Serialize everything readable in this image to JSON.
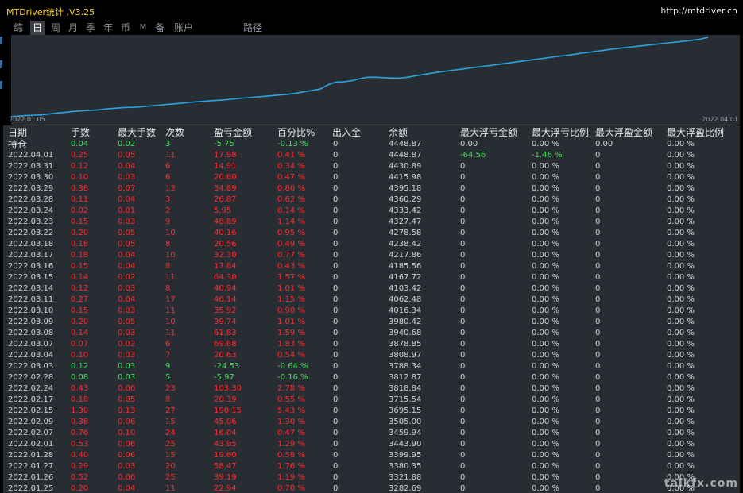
{
  "titlebar": {
    "app_title": "MTDriver统计 ,V3.25",
    "url": "http://mtdriver.cn"
  },
  "tabs": [
    {
      "label": "综",
      "active": false
    },
    {
      "label": "日",
      "active": true
    },
    {
      "label": "周",
      "active": false
    },
    {
      "label": "月",
      "active": false
    },
    {
      "label": "季",
      "active": false
    },
    {
      "label": "年",
      "active": false
    },
    {
      "label": "币",
      "active": false
    },
    {
      "label": "M",
      "active": false
    },
    {
      "label": "备",
      "active": false
    },
    {
      "label": "账户",
      "active": false
    },
    {
      "label": "路径",
      "active": false
    }
  ],
  "chart_data": {
    "type": "line",
    "x_start_label": "2022.01.05",
    "x_end_label": "2022.04.01",
    "line_color": "#29a3e0",
    "grid": false,
    "series": [
      {
        "values": [
          3300,
          3310,
          3318,
          3322,
          3330,
          3342,
          3355,
          3365,
          3378,
          3385,
          3392,
          3400,
          3412,
          3422,
          3430,
          3436,
          3440,
          3450,
          3460,
          3470,
          3480,
          3490,
          3500,
          3512,
          3520,
          3528,
          3536,
          3545,
          3556,
          3568,
          3575,
          3585,
          3595,
          3605,
          3615,
          3625,
          3640,
          3660,
          3680,
          3700,
          3760,
          3800,
          3805,
          3820,
          3850,
          3870,
          3872,
          3865,
          3860,
          3858,
          3870,
          3890,
          3910,
          3928,
          3945,
          3960,
          3975,
          3990,
          4005,
          4020,
          4035,
          4050,
          4065,
          4080,
          4095,
          4110,
          4125,
          4140,
          4158,
          4172,
          4185,
          4200,
          4218,
          4232,
          4248,
          4262,
          4278,
          4292,
          4305,
          4318,
          4330,
          4342,
          4355,
          4368,
          4380,
          4392,
          4405,
          4420,
          4448
        ]
      }
    ]
  },
  "table": {
    "headers": [
      "日期",
      "手数",
      "最大手数",
      "次数",
      "盈亏金额",
      "百分比%",
      "出入金",
      "余额",
      "最大浮亏金额",
      "最大浮亏比例",
      "最大浮盈金额",
      "最大浮盈比例"
    ],
    "holding": {
      "date": "持仓",
      "lots": "0.04",
      "max_lots": "0.02",
      "count": "3",
      "pl": "-5.75",
      "pct": "-0.13 %",
      "io": "0",
      "balance": "4448.87",
      "max_dd_amt": "0.00",
      "max_dd_pct": "0.00 %",
      "max_fp_amt": "0.00",
      "max_fp_pct": "0.00 %"
    },
    "rows": [
      {
        "date": "2022.04.01",
        "lots": "0.25",
        "max_lots": "0.05",
        "count": "11",
        "pl": "17.98",
        "pct": "0.41 %",
        "io": "0",
        "balance": "4448.87",
        "max_dd_amt": "-64.56",
        "max_dd_pct": "-1.46 %",
        "max_fp_amt": "0",
        "max_fp_pct": "0.00 %"
      },
      {
        "date": "2022.03.31",
        "lots": "0.12",
        "max_lots": "0.04",
        "count": "6",
        "pl": "14.91",
        "pct": "0.34 %",
        "io": "0",
        "balance": "4430.89",
        "max_dd_amt": "0",
        "max_dd_pct": "0.00 %",
        "max_fp_amt": "0",
        "max_fp_pct": "0.00 %"
      },
      {
        "date": "2022.03.30",
        "lots": "0.10",
        "max_lots": "0.03",
        "count": "6",
        "pl": "20.80",
        "pct": "0.47 %",
        "io": "0",
        "balance": "4415.98",
        "max_dd_amt": "0",
        "max_dd_pct": "0.00 %",
        "max_fp_amt": "0",
        "max_fp_pct": "0.00 %"
      },
      {
        "date": "2022.03.29",
        "lots": "0.38",
        "max_lots": "0.07",
        "count": "13",
        "pl": "34.89",
        "pct": "0.80 %",
        "io": "0",
        "balance": "4395.18",
        "max_dd_amt": "0",
        "max_dd_pct": "0.00 %",
        "max_fp_amt": "0",
        "max_fp_pct": "0.00 %"
      },
      {
        "date": "2022.03.28",
        "lots": "0.11",
        "max_lots": "0.04",
        "count": "3",
        "pl": "26.87",
        "pct": "0.62 %",
        "io": "0",
        "balance": "4360.29",
        "max_dd_amt": "0",
        "max_dd_pct": "0.00 %",
        "max_fp_amt": "0",
        "max_fp_pct": "0.00 %"
      },
      {
        "date": "2022.03.24",
        "lots": "0.02",
        "max_lots": "0.01",
        "count": "2",
        "pl": "5.95",
        "pct": "0.14 %",
        "io": "0",
        "balance": "4333.42",
        "max_dd_amt": "0",
        "max_dd_pct": "0.00 %",
        "max_fp_amt": "0",
        "max_fp_pct": "0.00 %"
      },
      {
        "date": "2022.03.23",
        "lots": "0.15",
        "max_lots": "0.03",
        "count": "9",
        "pl": "48.89",
        "pct": "1.14 %",
        "io": "0",
        "balance": "4327.47",
        "max_dd_amt": "0",
        "max_dd_pct": "0.00 %",
        "max_fp_amt": "0",
        "max_fp_pct": "0.00 %"
      },
      {
        "date": "2022.03.22",
        "lots": "0.20",
        "max_lots": "0.05",
        "count": "10",
        "pl": "40.16",
        "pct": "0.95 %",
        "io": "0",
        "balance": "4278.58",
        "max_dd_amt": "0",
        "max_dd_pct": "0.00 %",
        "max_fp_amt": "0",
        "max_fp_pct": "0.00 %"
      },
      {
        "date": "2022.03.18",
        "lots": "0.18",
        "max_lots": "0.05",
        "count": "8",
        "pl": "20.56",
        "pct": "0.49 %",
        "io": "0",
        "balance": "4238.42",
        "max_dd_amt": "0",
        "max_dd_pct": "0.00 %",
        "max_fp_amt": "0",
        "max_fp_pct": "0.00 %"
      },
      {
        "date": "2022.03.17",
        "lots": "0.18",
        "max_lots": "0.04",
        "count": "10",
        "pl": "32.30",
        "pct": "0.77 %",
        "io": "0",
        "balance": "4217.86",
        "max_dd_amt": "0",
        "max_dd_pct": "0.00 %",
        "max_fp_amt": "0",
        "max_fp_pct": "0.00 %"
      },
      {
        "date": "2022.03.16",
        "lots": "0.15",
        "max_lots": "0.04",
        "count": "8",
        "pl": "17.84",
        "pct": "0.43 %",
        "io": "0",
        "balance": "4185.56",
        "max_dd_amt": "0",
        "max_dd_pct": "0.00 %",
        "max_fp_amt": "0",
        "max_fp_pct": "0.00 %"
      },
      {
        "date": "2022.03.15",
        "lots": "0.14",
        "max_lots": "0.02",
        "count": "11",
        "pl": "64.30",
        "pct": "1.57 %",
        "io": "0",
        "balance": "4167.72",
        "max_dd_amt": "0",
        "max_dd_pct": "0.00 %",
        "max_fp_amt": "0",
        "max_fp_pct": "0.00 %"
      },
      {
        "date": "2022.03.14",
        "lots": "0.12",
        "max_lots": "0.03",
        "count": "8",
        "pl": "40.94",
        "pct": "1.01 %",
        "io": "0",
        "balance": "4103.42",
        "max_dd_amt": "0",
        "max_dd_pct": "0.00 %",
        "max_fp_amt": "0",
        "max_fp_pct": "0.00 %"
      },
      {
        "date": "2022.03.11",
        "lots": "0.27",
        "max_lots": "0.04",
        "count": "17",
        "pl": "46.14",
        "pct": "1.15 %",
        "io": "0",
        "balance": "4062.48",
        "max_dd_amt": "0",
        "max_dd_pct": "0.00 %",
        "max_fp_amt": "0",
        "max_fp_pct": "0.00 %"
      },
      {
        "date": "2022.03.10",
        "lots": "0.15",
        "max_lots": "0.03",
        "count": "11",
        "pl": "35.92",
        "pct": "0.90 %",
        "io": "0",
        "balance": "4016.34",
        "max_dd_amt": "0",
        "max_dd_pct": "0.00 %",
        "max_fp_amt": "0",
        "max_fp_pct": "0.00 %"
      },
      {
        "date": "2022.03.09",
        "lots": "0.20",
        "max_lots": "0.05",
        "count": "10",
        "pl": "39.74",
        "pct": "1.01 %",
        "io": "0",
        "balance": "3980.42",
        "max_dd_amt": "0",
        "max_dd_pct": "0.00 %",
        "max_fp_amt": "0",
        "max_fp_pct": "0.00 %"
      },
      {
        "date": "2022.03.08",
        "lots": "0.14",
        "max_lots": "0.03",
        "count": "11",
        "pl": "61.83",
        "pct": "1.59 %",
        "io": "0",
        "balance": "3940.68",
        "max_dd_amt": "0",
        "max_dd_pct": "0.00 %",
        "max_fp_amt": "0",
        "max_fp_pct": "0.00 %"
      },
      {
        "date": "2022.03.07",
        "lots": "0.07",
        "max_lots": "0.02",
        "count": "6",
        "pl": "69.88",
        "pct": "1.83 %",
        "io": "0",
        "balance": "3878.85",
        "max_dd_amt": "0",
        "max_dd_pct": "0.00 %",
        "max_fp_amt": "0",
        "max_fp_pct": "0.00 %"
      },
      {
        "date": "2022.03.04",
        "lots": "0.10",
        "max_lots": "0.03",
        "count": "7",
        "pl": "20.63",
        "pct": "0.54 %",
        "io": "0",
        "balance": "3808.97",
        "max_dd_amt": "0",
        "max_dd_pct": "0.00 %",
        "max_fp_amt": "0",
        "max_fp_pct": "0.00 %"
      },
      {
        "date": "2022.03.03",
        "lots": "0.12",
        "max_lots": "0.03",
        "count": "9",
        "pl": "-24.53",
        "pct": "-0.64 %",
        "io": "0",
        "balance": "3788.34",
        "max_dd_amt": "0",
        "max_dd_pct": "0.00 %",
        "max_fp_amt": "0",
        "max_fp_pct": "0.00 %"
      },
      {
        "date": "2022.02.28",
        "lots": "0.08",
        "max_lots": "0.03",
        "count": "5",
        "pl": "-5.97",
        "pct": "-0.16 %",
        "io": "0",
        "balance": "3812.87",
        "max_dd_amt": "0",
        "max_dd_pct": "0.00 %",
        "max_fp_amt": "0",
        "max_fp_pct": "0.00 %"
      },
      {
        "date": "2022.02.24",
        "lots": "0.43",
        "max_lots": "0.06",
        "count": "23",
        "pl": "103.30",
        "pct": "2.78 %",
        "io": "0",
        "balance": "3818.84",
        "max_dd_amt": "0",
        "max_dd_pct": "0.00 %",
        "max_fp_amt": "0",
        "max_fp_pct": "0.00 %"
      },
      {
        "date": "2022.02.17",
        "lots": "0.18",
        "max_lots": "0.05",
        "count": "8",
        "pl": "20.39",
        "pct": "0.55 %",
        "io": "0",
        "balance": "3715.54",
        "max_dd_amt": "0",
        "max_dd_pct": "0.00 %",
        "max_fp_amt": "0",
        "max_fp_pct": "0.00 %"
      },
      {
        "date": "2022.02.15",
        "lots": "1.30",
        "max_lots": "0.13",
        "count": "27",
        "pl": "190.15",
        "pct": "5.43 %",
        "io": "0",
        "balance": "3695.15",
        "max_dd_amt": "0",
        "max_dd_pct": "0.00 %",
        "max_fp_amt": "0",
        "max_fp_pct": "0.00 %"
      },
      {
        "date": "2022.02.09",
        "lots": "0.38",
        "max_lots": "0.06",
        "count": "15",
        "pl": "45.06",
        "pct": "1.30 %",
        "io": "0",
        "balance": "3505.00",
        "max_dd_amt": "0",
        "max_dd_pct": "0.00 %",
        "max_fp_amt": "0",
        "max_fp_pct": "0.00 %"
      },
      {
        "date": "2022.02.07",
        "lots": "0.76",
        "max_lots": "0.10",
        "count": "24",
        "pl": "16.04",
        "pct": "0.47 %",
        "io": "0",
        "balance": "3459.94",
        "max_dd_amt": "0",
        "max_dd_pct": "0.00 %",
        "max_fp_amt": "0",
        "max_fp_pct": "0.00 %"
      },
      {
        "date": "2022.02.01",
        "lots": "0.53",
        "max_lots": "0.06",
        "count": "25",
        "pl": "43.95",
        "pct": "1.29 %",
        "io": "0",
        "balance": "3443.90",
        "max_dd_amt": "0",
        "max_dd_pct": "0.00 %",
        "max_fp_amt": "0",
        "max_fp_pct": "0.00 %"
      },
      {
        "date": "2022.01.28",
        "lots": "0.40",
        "max_lots": "0.06",
        "count": "15",
        "pl": "19.60",
        "pct": "0.58 %",
        "io": "0",
        "balance": "3399.95",
        "max_dd_amt": "0",
        "max_dd_pct": "0.00 %",
        "max_fp_amt": "0",
        "max_fp_pct": "0.00 %"
      },
      {
        "date": "2022.01.27",
        "lots": "0.29",
        "max_lots": "0.03",
        "count": "20",
        "pl": "58.47",
        "pct": "1.76 %",
        "io": "0",
        "balance": "3380.35",
        "max_dd_amt": "0",
        "max_dd_pct": "0.00 %",
        "max_fp_amt": "0",
        "max_fp_pct": "0.00 %"
      },
      {
        "date": "2022.01.26",
        "lots": "0.52",
        "max_lots": "0.06",
        "count": "25",
        "pl": "39.19",
        "pct": "1.19 %",
        "io": "0",
        "balance": "3321.88",
        "max_dd_amt": "0",
        "max_dd_pct": "0.00 %",
        "max_fp_amt": "0",
        "max_fp_pct": "0.00 %"
      },
      {
        "date": "2022.01.25",
        "lots": "0.20",
        "max_lots": "0.04",
        "count": "11",
        "pl": "22.94",
        "pct": "0.70 %",
        "io": "0",
        "balance": "3282.69",
        "max_dd_amt": "0",
        "max_dd_pct": "0.00 %",
        "max_fp_amt": "0",
        "max_fp_pct": "0.00 %"
      }
    ]
  },
  "watermark": "talkfx.com",
  "colors": {
    "positive": "#ff2b2b",
    "negative": "#3fe15a",
    "accent_title": "#ffd21c",
    "panel": "#282c33",
    "line": "#29a3e0"
  }
}
